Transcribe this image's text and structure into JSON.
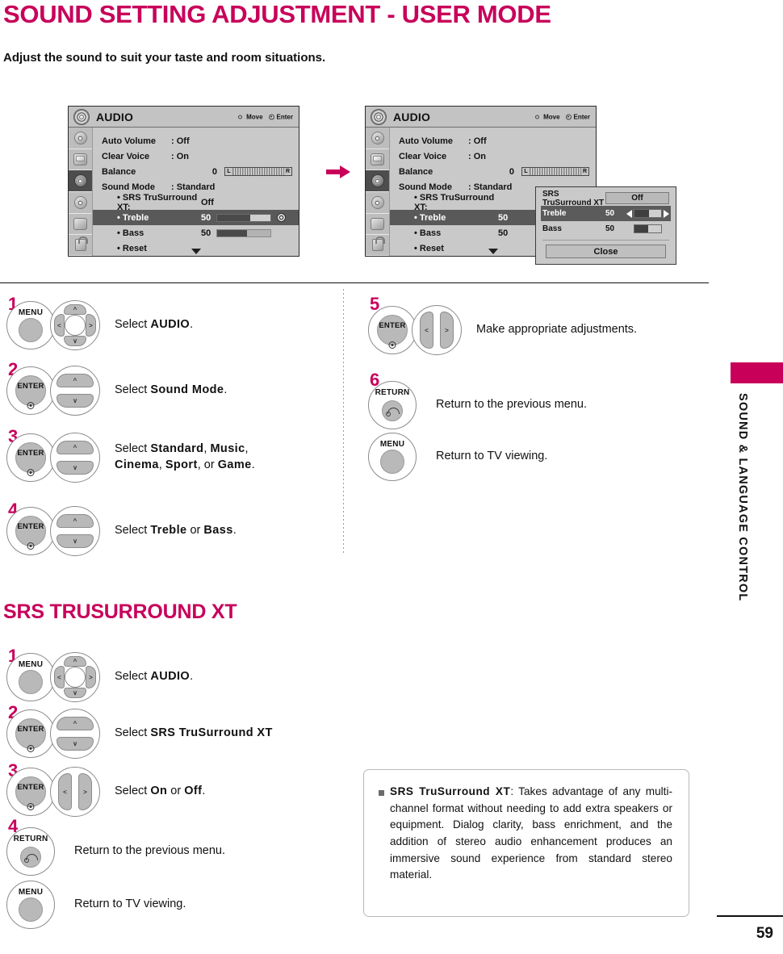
{
  "page": {
    "title": "SOUND SETTING ADJUSTMENT - USER MODE",
    "subtitle": "Adjust the sound to suit your taste and room situations.",
    "section_title": "SRS TRUSURROUND XT",
    "page_number": "59",
    "sidebar_label": "SOUND & LANGUAGE CONTROL",
    "accent_color": "#c8005a"
  },
  "osd": {
    "title": "AUDIO",
    "hint_move": "Move",
    "hint_enter": "Enter",
    "rail_icons": [
      "picture-icon",
      "screen-icon",
      "audio-icon",
      "time-icon",
      "option-icon",
      "lock-icon"
    ],
    "rows": [
      {
        "label": "Auto Volume",
        "value": ": Off"
      },
      {
        "label": "Clear Voice",
        "value": ": On"
      },
      {
        "label": "Balance",
        "value": "0"
      },
      {
        "label": "Sound Mode",
        "value": ": Standard"
      }
    ],
    "sub_rows": [
      {
        "label": "• SRS TruSurround XT:",
        "value": "Off"
      },
      {
        "label": "• Treble",
        "value": "50"
      },
      {
        "label": "• Bass",
        "value": "50"
      },
      {
        "label": "• Reset",
        "value": ""
      }
    ],
    "balance_left": "L",
    "balance_right": "R",
    "treble_percent": 62,
    "bass_percent": 55
  },
  "popup": {
    "rows": [
      {
        "label": "SRS TruSurround XT",
        "value": "",
        "state": "Off"
      },
      {
        "label": "Treble",
        "value": "50"
      },
      {
        "label": "Bass",
        "value": "50"
      }
    ],
    "close_label": "Close",
    "treble_percent": 55,
    "bass_percent": 50
  },
  "steps_user_mode": [
    {
      "num": "1",
      "button": "MENU",
      "pad": "four",
      "text_prefix": "Select ",
      "text_bold": "AUDIO",
      "text_suffix": "."
    },
    {
      "num": "2",
      "button": "ENTER",
      "pad": "ud",
      "text_prefix": "Select ",
      "text_bold": "Sound Mode",
      "text_suffix": "."
    },
    {
      "num": "3",
      "button": "ENTER",
      "pad": "ud",
      "line1_prefix": "Select ",
      "line1_bold_a": "Standard",
      "line1_mid": ", ",
      "line1_bold_b": "Music",
      "line1_suffix": ",",
      "line2_bold_a": "Cinema",
      "line2_mid1": ", ",
      "line2_bold_b": "Sport",
      "line2_mid2": ", or ",
      "line2_bold_c": "Game",
      "line2_suffix": "."
    },
    {
      "num": "4",
      "button": "ENTER",
      "pad": "ud",
      "text_prefix": "Select ",
      "text_bold": "Treble",
      "text_mid": " or ",
      "text_bold_b": "Bass",
      "text_suffix": "."
    }
  ],
  "steps_user_mode_right": [
    {
      "num": "5",
      "button": "ENTER",
      "pad": "lr",
      "text": "Make appropriate adjustments."
    },
    {
      "num": "6",
      "button": "RETURN",
      "pad": "none",
      "text": "Return to the previous menu."
    },
    {
      "num": "",
      "button": "MENU",
      "pad": "none",
      "text": "Return to TV viewing."
    }
  ],
  "steps_srs": [
    {
      "num": "1",
      "button": "MENU",
      "pad": "four",
      "text_prefix": "Select ",
      "text_bold": "AUDIO",
      "text_suffix": "."
    },
    {
      "num": "2",
      "button": "ENTER",
      "pad": "ud",
      "text_prefix": "Select ",
      "text_bold": "SRS TruSurround XT",
      "text_suffix": ""
    },
    {
      "num": "3",
      "button": "ENTER",
      "pad": "lr",
      "text_prefix": "Select ",
      "text_bold": "On",
      "text_mid": " or ",
      "text_bold_b": "Off",
      "text_suffix": "."
    },
    {
      "num": "4",
      "button": "RETURN",
      "pad": "none",
      "text": "Return to the previous menu."
    },
    {
      "num": "",
      "button": "MENU",
      "pad": "none",
      "text": "Return to TV viewing."
    }
  ],
  "note": {
    "bold": "SRS TruSurround XT",
    "body": ": Takes advantage of any multi-channel format without needing to add extra speakers or equipment. Dialog clarity, bass enrichment, and the addition of stereo audio enhancement produces an immersive sound experience from standard stereo material."
  }
}
